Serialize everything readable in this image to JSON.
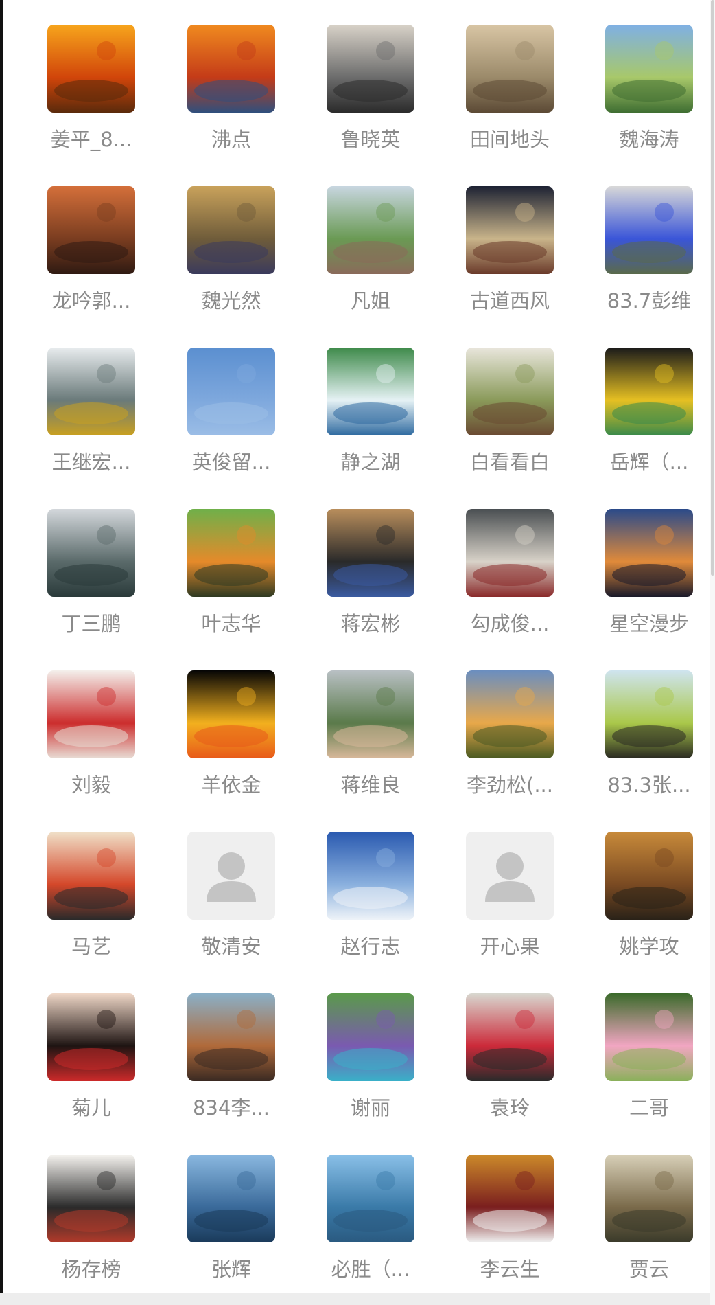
{
  "members": [
    {
      "name": "姜平_8...",
      "icon": "sunset-person-icon",
      "colors": [
        "#f7a51c",
        "#d1450a",
        "#5a2a0b"
      ]
    },
    {
      "name": "沸点",
      "icon": "sunrise-clouds-icon",
      "colors": [
        "#f08a1f",
        "#c43b18",
        "#2f4f7d"
      ]
    },
    {
      "name": "鲁晓英",
      "icon": "cat-icon",
      "colors": [
        "#d8d2c8",
        "#6c6c6c",
        "#2b2b2b"
      ]
    },
    {
      "name": "田间地头",
      "icon": "room-photo-icon",
      "colors": [
        "#d8c5a4",
        "#9b8a6a",
        "#5c4a35"
      ]
    },
    {
      "name": "魏海涛",
      "icon": "landscape-lake-icon",
      "colors": [
        "#7fb0e4",
        "#a8c86a",
        "#3f6e32"
      ]
    },
    {
      "name": "龙吟郭...",
      "icon": "calligraphy-sign-icon",
      "colors": [
        "#d46f3a",
        "#7a3d20",
        "#2f1a12"
      ]
    },
    {
      "name": "魏光然",
      "icon": "collage-portrait-icon",
      "colors": [
        "#c9a25b",
        "#6f5c3a",
        "#3a3a5c"
      ]
    },
    {
      "name": "凡姐",
      "icon": "person-meadow-icon",
      "colors": [
        "#c8d6e0",
        "#6a9a54",
        "#8a6a5a"
      ]
    },
    {
      "name": "古道西风",
      "icon": "night-lights-icon",
      "colors": [
        "#1d2233",
        "#c9b48a",
        "#6a3a2a"
      ]
    },
    {
      "name": "83.7彭维",
      "icon": "blue-flower-icon",
      "colors": [
        "#d8d8d8",
        "#3a55d8",
        "#5a6a4a"
      ]
    },
    {
      "name": "王继宏...",
      "icon": "snow-canyon-icon",
      "colors": [
        "#e8ecee",
        "#6a7a7a",
        "#c9a020"
      ]
    },
    {
      "name": "英俊留...",
      "icon": "blue-sky-icon",
      "colors": [
        "#5b8fd0",
        "#7ea8dd",
        "#9bbde6"
      ]
    },
    {
      "name": "静之湖",
      "icon": "waterfall-icon",
      "colors": [
        "#3e8a4a",
        "#e6f2f5",
        "#2f6aa0"
      ]
    },
    {
      "name": "白看看白",
      "icon": "cactus-icon",
      "colors": [
        "#e9e6dc",
        "#8a9a5a",
        "#6a4a32"
      ]
    },
    {
      "name": "岳辉（...",
      "icon": "book-cover-icon",
      "colors": [
        "#1a1a1a",
        "#e6c022",
        "#3a8a4a"
      ]
    },
    {
      "name": "丁三鹏",
      "icon": "mountain-lake-icon",
      "colors": [
        "#d4d8dc",
        "#5a6a6a",
        "#2a3a3a"
      ]
    },
    {
      "name": "叶志华",
      "icon": "monk-figure-icon",
      "colors": [
        "#6fb04a",
        "#e58a2a",
        "#2f3a22"
      ]
    },
    {
      "name": "蒋宏彬",
      "icon": "glasses-portrait-icon",
      "colors": [
        "#b98e5c",
        "#2a2a2a",
        "#3a5aa0"
      ]
    },
    {
      "name": "勾成俊...",
      "icon": "gate-building-icon",
      "colors": [
        "#4a4f52",
        "#d8d2c8",
        "#8a2a2a"
      ]
    },
    {
      "name": "星空漫步",
      "icon": "city-skyline-icon",
      "colors": [
        "#2a4a8a",
        "#e08a3a",
        "#1a1a2a"
      ]
    },
    {
      "name": "刘毅",
      "icon": "fu-character-icon",
      "colors": [
        "#f4f0ec",
        "#cc2d2d",
        "#e8dcd4"
      ]
    },
    {
      "name": "羊依金",
      "icon": "cartoon-star-icon",
      "colors": [
        "#050505",
        "#f2b01e",
        "#e85a1a"
      ]
    },
    {
      "name": "蒋维良",
      "icon": "foggy-forest-icon",
      "colors": [
        "#b9c0c4",
        "#5a7a4a",
        "#d8b89a"
      ]
    },
    {
      "name": "李劲松(...",
      "icon": "field-sunset-icon",
      "colors": [
        "#6a8ec0",
        "#e8a84a",
        "#4a5a22"
      ]
    },
    {
      "name": "83.3张...",
      "icon": "horse-grassland-icon",
      "colors": [
        "#cfe4ef",
        "#aac84a",
        "#2a2a22"
      ]
    },
    {
      "name": "马艺",
      "icon": "opera-art-icon",
      "colors": [
        "#f0e0c8",
        "#d4472a",
        "#2a2a2a"
      ]
    },
    {
      "name": "敬清安",
      "icon": "default-avatar-icon",
      "colors": [
        "#efefef",
        "#c4c4c4",
        "#c4c4c4"
      ]
    },
    {
      "name": "赵行志",
      "icon": "sky-cloud-sea-icon",
      "colors": [
        "#2a5ab0",
        "#8ab0de",
        "#eef3f8"
      ]
    },
    {
      "name": "开心果",
      "icon": "default-avatar-icon",
      "colors": [
        "#efefef",
        "#c4c4c4",
        "#c4c4c4"
      ]
    },
    {
      "name": "姚学攻",
      "icon": "golden-mountains-icon",
      "colors": [
        "#c88a3a",
        "#7a4a22",
        "#2a2218"
      ]
    },
    {
      "name": "菊儿",
      "icon": "woman-portrait-icon",
      "colors": [
        "#f0d8c8",
        "#1e1412",
        "#cc2a2a"
      ]
    },
    {
      "name": "834李...",
      "icon": "autumn-lake-icon",
      "colors": [
        "#8ab0c8",
        "#b06a3a",
        "#3a2a22"
      ]
    },
    {
      "name": "谢丽",
      "icon": "lavender-field-icon",
      "colors": [
        "#5a9a4a",
        "#7a5ab0",
        "#3ab0c8"
      ]
    },
    {
      "name": "袁玲",
      "icon": "photographer-icon",
      "colors": [
        "#d8d8d0",
        "#cc2a3a",
        "#2a2a2a"
      ]
    },
    {
      "name": "二哥",
      "icon": "lotus-flower-icon",
      "colors": [
        "#3a6a2a",
        "#f2a6c2",
        "#8ab05a"
      ]
    },
    {
      "name": "杨存榜",
      "icon": "vase-calligraphy-icon",
      "colors": [
        "#f6f4f0",
        "#2a2a2a",
        "#b23a2a"
      ]
    },
    {
      "name": "张辉",
      "icon": "blue-lake-icon",
      "colors": [
        "#8ab8e0",
        "#3a6a9a",
        "#1a3a5a"
      ]
    },
    {
      "name": "必胜（...",
      "icon": "harbor-city-icon",
      "colors": [
        "#8ac0e8",
        "#3a7aa8",
        "#2a5a80"
      ]
    },
    {
      "name": "李云生",
      "icon": "restaurant-man-icon",
      "colors": [
        "#cc8a2a",
        "#7a1e1e",
        "#f0f0f0"
      ]
    },
    {
      "name": "贾云",
      "icon": "little-monk-icon",
      "colors": [
        "#d8d0b8",
        "#7a6a4a",
        "#3a3a2a"
      ]
    }
  ]
}
